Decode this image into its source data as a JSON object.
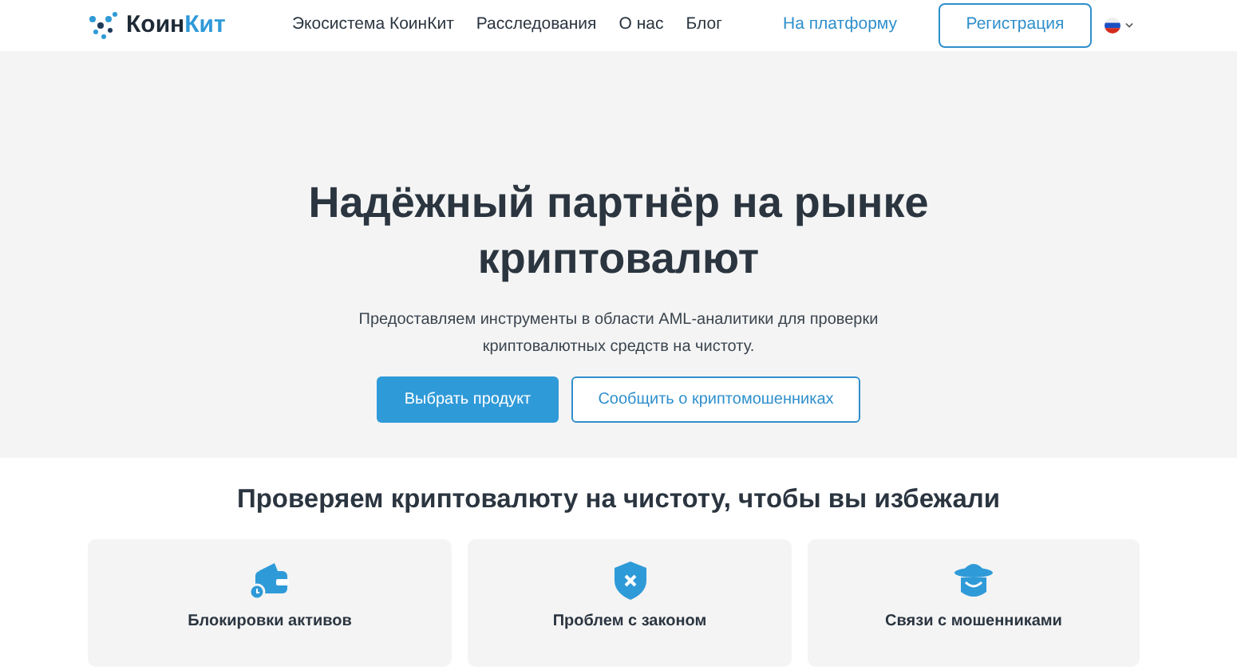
{
  "header": {
    "logo": [
      "Коин",
      "Кит"
    ],
    "nav": [
      "Экосистема КоинКит",
      "Расследования",
      "О нас",
      "Блог"
    ],
    "platform_link": "На платформу",
    "register_button": "Регистрация"
  },
  "hero": {
    "title": "Надёжный партнёр на рынке криптовалют",
    "subtitle": "Предоставляем инструменты в области AML-аналитики для проверки криптовалютных средств на чистоту.",
    "primary_button": "Выбрать продукт",
    "secondary_button": "Сообщить о криптомошенниках"
  },
  "section": {
    "title": "Проверяем криптовалюту на чистоту, чтобы вы избежали",
    "cards": [
      {
        "kind": "wallet",
        "label": "Блокировки активов"
      },
      {
        "kind": "shield",
        "label": "Проблем с законом"
      },
      {
        "kind": "spy",
        "label": "Связи с мошенниками"
      }
    ]
  }
}
